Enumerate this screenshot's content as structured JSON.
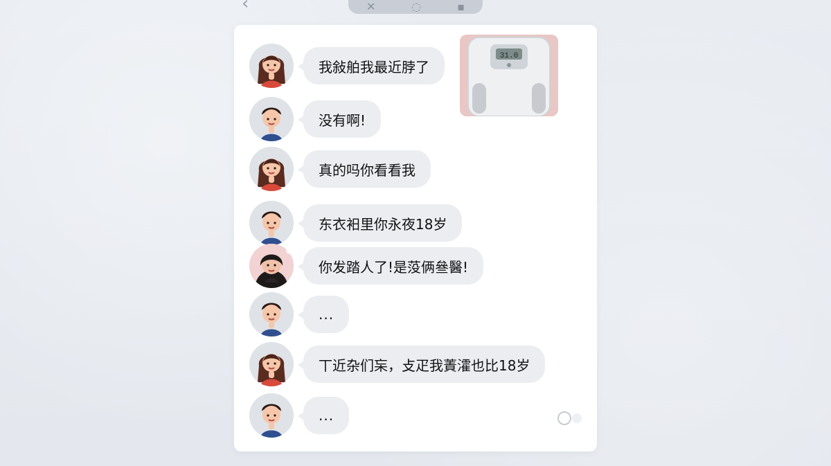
{
  "top_bar": {
    "back_icon": "chevron-left-icon",
    "pill_icons": [
      "tag-icon",
      "heart-shield-icon",
      "trash-icon"
    ]
  },
  "thumbnail": {
    "scale_reading": "31.0"
  },
  "messages": [
    {
      "sender": "female",
      "text": "我敍舶我最近脖了"
    },
    {
      "sender": "male",
      "text": "没有啊!"
    },
    {
      "sender": "female",
      "text": "真的吗你看看我"
    },
    {
      "sender": "male",
      "text": "东衣衵里你永夜18岁"
    },
    {
      "sender": "photo_female",
      "text": "你发踏人了!是莈俩叄醫!"
    },
    {
      "sender": "male",
      "text": "..."
    },
    {
      "sender": "female",
      "text": "丅近杂们杗，攴疋我蔶瀖也比18岁"
    },
    {
      "sender": "male",
      "text": "..."
    }
  ],
  "colors": {
    "background": "#e8ebf0",
    "card": "#ffffff",
    "bubble": "#ebedf1",
    "text": "#111111"
  }
}
